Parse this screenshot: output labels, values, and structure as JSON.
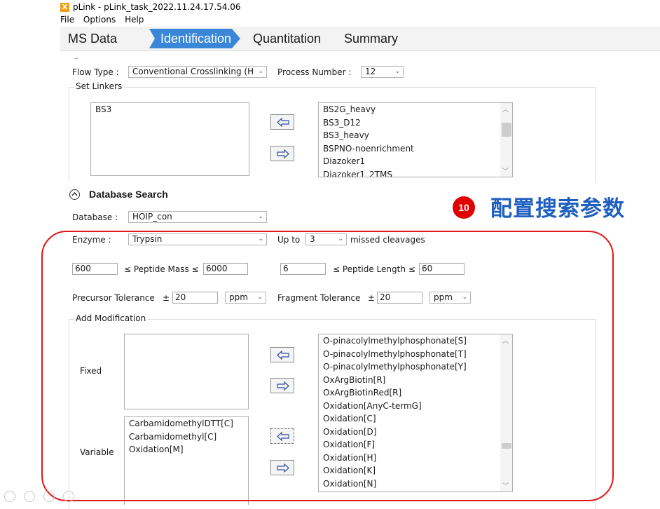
{
  "window": {
    "title": "pLink - pLink_task_2022.11.24.17.54.06",
    "logo": "X"
  },
  "menu": [
    "File",
    "Options",
    "Help"
  ],
  "tabs": [
    {
      "label": "MS Data",
      "active": false
    },
    {
      "label": "Identification",
      "active": true
    },
    {
      "label": "Quantitation",
      "active": false
    },
    {
      "label": "Summary",
      "active": false
    }
  ],
  "flow": {
    "flow_type_label": "Flow Type :",
    "flow_type_value": "Conventional Crosslinking (H",
    "process_number_label": "Process Number :",
    "process_number_value": "12",
    "set_linkers_label": "Set Linkers",
    "selected_linkers": [
      "BS3"
    ],
    "available_linkers": [
      "BS2G_heavy",
      "BS3_D12",
      "BS3_heavy",
      "BSPNO-noenrichment",
      "Diazoker1",
      "Diazoker1_2TMS"
    ]
  },
  "database_search": {
    "section_title": "Database Search",
    "database_label": "Database :",
    "database_value": "HOIP_con",
    "enzyme_label": "Enzyme :",
    "enzyme_value": "Trypsin",
    "upto_label": "Up to",
    "upto_value": "3",
    "missed_label": "missed cleavages",
    "mass_min": "600",
    "mass_label": "≤ Peptide Mass ≤",
    "mass_max": "6000",
    "length_min": "6",
    "length_label": "≤ Peptide Length ≤",
    "length_max": "60",
    "precursor_label": "Precursor Tolerance",
    "precursor_pm": "±",
    "precursor_value": "20",
    "precursor_unit": "ppm",
    "fragment_label": "Fragment Tolerance",
    "fragment_pm": "±",
    "fragment_value": "20",
    "fragment_unit": "ppm"
  },
  "modification": {
    "group_label": "Add Modification",
    "fixed_label": "Fixed",
    "variable_label": "Variable",
    "fixed_items": [],
    "variable_items": [
      "CarbamidomethylDTT[C]",
      "Carbamidomethyl[C]",
      "Oxidation[M]"
    ],
    "available_items": [
      "O-pinacolylmethylphosphonate[S]",
      "O-pinacolylmethylphosphonate[T]",
      "O-pinacolylmethylphosphonate[Y]",
      "OxArgBiotin[R]",
      "OxArgBiotinRed[R]",
      "Oxidation[AnyC-termG]",
      "Oxidation[C]",
      "Oxidation[D]",
      "Oxidation[F]",
      "Oxidation[H]",
      "Oxidation[K]",
      "Oxidation[N]"
    ]
  },
  "annotation": {
    "badge": "10",
    "text": "配置搜索参数",
    "color": "#1f5fbf",
    "highlight_color": "#e01818"
  },
  "colors": {
    "active_tab": "#3a86d8",
    "badge": "#e00000"
  }
}
